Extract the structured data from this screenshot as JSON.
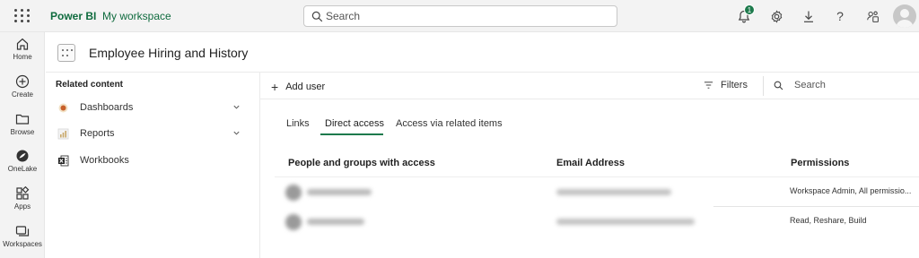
{
  "topbar": {
    "brand": "Power BI",
    "workspace": "My workspace",
    "search_placeholder": "Search",
    "notification_count": "1",
    "icons": [
      "waffle-icon",
      "bell-icon",
      "gear-icon",
      "download-icon",
      "help-icon",
      "share-icon",
      "avatar"
    ]
  },
  "leftnav": {
    "items": [
      {
        "label": "Home",
        "icon": "home-icon"
      },
      {
        "label": "Create",
        "icon": "plus-circle-icon"
      },
      {
        "label": "Browse",
        "icon": "folder-icon"
      },
      {
        "label": "OneLake",
        "icon": "onelake-icon"
      },
      {
        "label": "Apps",
        "icon": "apps-icon"
      },
      {
        "label": "Workspaces",
        "icon": "workspaces-icon"
      }
    ]
  },
  "header": {
    "title": "Employee Hiring and History"
  },
  "related": {
    "heading": "Related content",
    "items": [
      {
        "label": "Dashboards",
        "icon": "dashboard-icon",
        "expandable": true
      },
      {
        "label": "Reports",
        "icon": "report-icon",
        "expandable": true
      },
      {
        "label": "Workbooks",
        "icon": "excel-icon",
        "expandable": false
      }
    ]
  },
  "commandbar": {
    "add_user": "Add user",
    "filters": "Filters",
    "search_placeholder": "Search"
  },
  "tabs": {
    "items": [
      "Links",
      "Direct access",
      "Access via related items"
    ],
    "active": "Direct access"
  },
  "table": {
    "columns": [
      "People and groups with access",
      "Email Address",
      "Permissions"
    ],
    "rows": [
      {
        "name": "",
        "email": "",
        "permissions": "Workspace Admin, All permissio..."
      },
      {
        "name": "",
        "email": "",
        "permissions": "Read, Reshare, Build"
      }
    ]
  },
  "colors": {
    "accent": "#1d7a4c",
    "brand": "#0f6b3e",
    "chrome": "#f3f3f3"
  }
}
